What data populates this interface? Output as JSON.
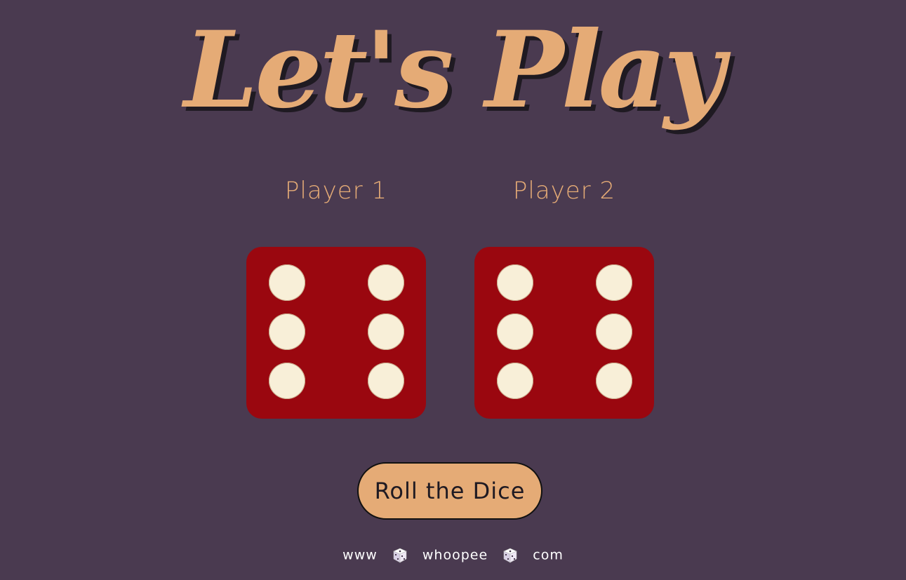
{
  "title": "Let's Play",
  "players": [
    {
      "label": "Player 1",
      "die_value": 6
    },
    {
      "label": "Player 2",
      "die_value": 6
    }
  ],
  "button": {
    "label": "Roll the Dice"
  },
  "footer": {
    "part1": "www",
    "part2": "whoopee",
    "part3": "com",
    "separator_icon": "dice-icon"
  },
  "colors": {
    "background": "#4a3a50",
    "accent": "#e5ab76",
    "die": "#9a070f",
    "pip": "#f8efd8"
  }
}
